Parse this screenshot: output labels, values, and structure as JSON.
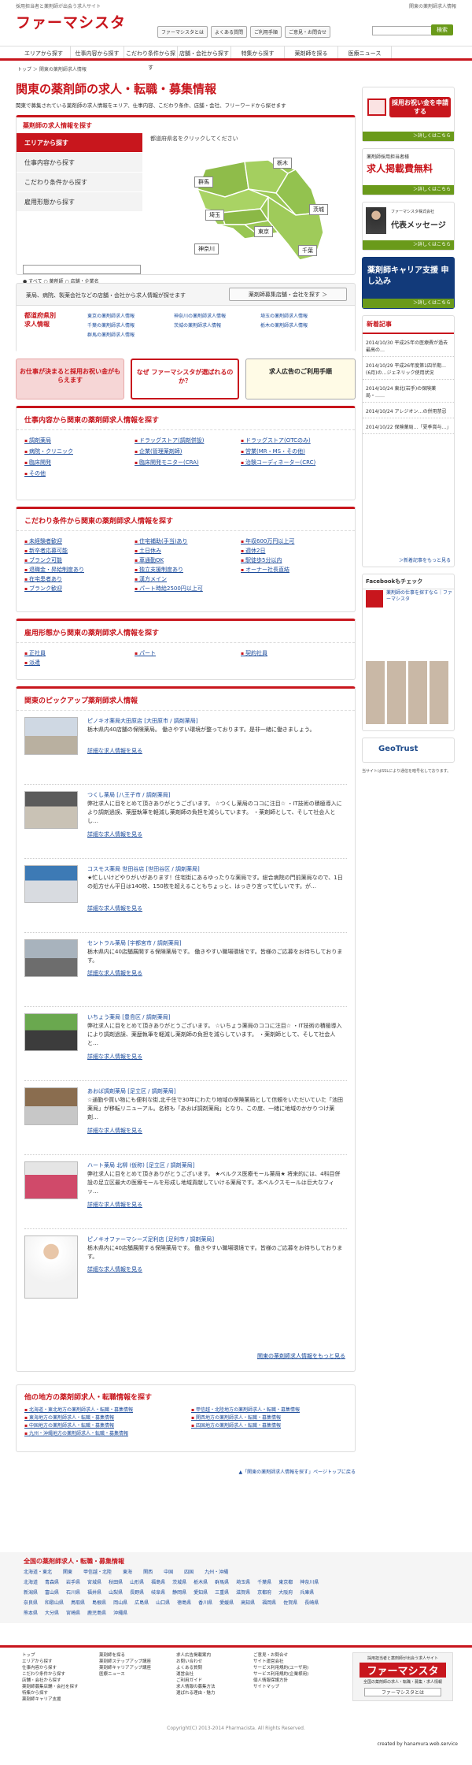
{
  "header": {
    "tagline": "採用担当者と薬剤師が出会う求人サイト",
    "logo": "ファーマシスタ",
    "right_note": "関東の薬剤師求人情報",
    "toplinks": [
      "ファーマシスタとは",
      "よくある質問",
      "ご利用手順",
      "ご意見・お問合せ"
    ],
    "search_button": "検索"
  },
  "nav": [
    "エリアから探す",
    "仕事内容から探す",
    "こだわり条件から探す",
    "店舗・会社から探す",
    "特集から探す",
    "薬剤師を探る",
    "医療ニュース"
  ],
  "breadcrumb": "トップ ＞ 関東の薬剤師求人情報",
  "main": {
    "title": "関東の薬剤師の求人・転職・募集情報",
    "lead": "関東で募集されている薬剤師の求人情報をエリア、仕事内容、こだわり条件、店舗・会社、フリーワードから探せます",
    "search_title": "薬剤師の求人情報を探す",
    "tabs": [
      "エリアから探す",
      "仕事内容から探す",
      "こだわり条件から探す",
      "雇用形態から探す"
    ],
    "map_hint": "都道府県名をクリックしてください",
    "prefs": [
      "群馬",
      "栃木",
      "茨城",
      "埼玉",
      "東京",
      "千葉",
      "神奈川"
    ],
    "radios": "● すべて ○ 薬剤師 ○ 店舗・企業名",
    "search_button": "検 索",
    "corp_text": "薬局、病院、製薬会社などの店舗・会社から求人情報が探せます",
    "corp_button": "薬剤師募集店舗・会社を探す ＞",
    "pref_label": "都道府県別求人情報",
    "pref_links": [
      "東京の薬剤師求人情報",
      "神奈川の薬剤師求人情報",
      "埼玉の薬剤師求人情報",
      "千葉の薬剤師求人情報",
      "茨城の薬剤師求人情報",
      "栃木の薬剤師求人情報",
      "群馬の薬剤師求人情報"
    ],
    "banners": [
      "お仕事が決まると採用お祝い金がもらえます",
      "なぜ ファーマシスタが選ばれるのか？",
      "求人広告のご利用手順"
    ],
    "job_title": "仕事内容から関東の薬剤師求人情報を探す",
    "jobs": [
      "調剤薬局",
      "ドラッグストア(調剤併設)",
      "ドラッグストア(OTCのみ)",
      "病院・クリニック",
      "企業(管理薬剤師)",
      "営業(MR・MS・その他)",
      "臨床開発",
      "臨床開発モニター(CRA)",
      "治験コーディネーター(CRC)",
      "その他"
    ],
    "kodawari_title": "こだわり条件から関東の薬剤師求人情報を探す",
    "kodawari": [
      "未経験者歓迎",
      "住宅補助(手当)あり",
      "年収600万円以上可",
      "新卒者応募可能",
      "土日休み",
      "週休2日",
      "ブランク可能",
      "車通勤OK",
      "駅徒歩5分以内",
      "退職金・昇給制度あり",
      "独立支援制度あり",
      "オーナー社長直結",
      "在宅患者あり",
      "漢方メイン",
      "ブランク歓迎",
      "パート時給2500円以上可"
    ],
    "koyou_title": "雇用形態から関東の薬剤師求人情報を探す",
    "koyou": [
      "正社員",
      "パート",
      "契約社員",
      "派遣"
    ],
    "pickup_title": "関東のピックアップ薬剤師求人情報",
    "pickups": [
      {
        "name": "ピノキオ薬局大田原店 [大田原市 / 調剤薬局]",
        "text": "栃木県内40店舗の保険薬局。 働きやすい環境が整っております。是非一緒に働きましょう。",
        "link": "詳細な求人情報を見る"
      },
      {
        "name": "つくし薬局 [八王子市 / 調剤薬局]",
        "text": "弊社求人に目をとめて頂きありがとうございます。 ☆つくし薬局のココに注目☆ ・IT技術の積極導入により調剤過誤、薬歴執筆を軽減し薬剤師の負担を減らしています。 ・薬剤師として、そして社会人とし…",
        "link": "詳細な求人情報を見る"
      },
      {
        "name": "コスモス薬局 世田谷店 [世田谷区 / 調剤薬局]",
        "text": "★忙しいけどやりがいがあります！住宅街にあるゆったりな薬局です。総合病院の門前薬局なので、1日の処方せん平日は140枚、150枚を超えることもちょっと、はっきり言って忙しいです。が…",
        "link": "詳細な求人情報を見る"
      },
      {
        "name": "セントラル薬局 [宇都宮市 / 調剤薬局]",
        "text": "栃木県内に40店舗展開する保険薬局です。 働きやすい職場環境です。皆様のご応募をお待ちしております。",
        "link": "詳細な求人情報を見る"
      },
      {
        "name": "いちょう薬局 [豊島区 / 調剤薬局]",
        "text": "弊社求人に目をとめて頂きありがとうございます。 ☆いちょう薬局のココに注目☆ ・IT技術の積極導入により調剤過誤、薬歴執筆を軽減し薬剤師の負担を減らしています。 ・薬剤師として、そして社会人と…",
        "link": "詳細な求人情報を見る"
      },
      {
        "name": "あおば調剤薬局 [足立区 / 調剤薬局]",
        "text": "☆通勤や買い物にも便利な街,北千住で30年にわたり地域の保険薬局として信頼をいただいていた「池田薬局」が移転リニューアル。名称も「あおば調剤薬局」となり、この度、一緒に地域のかかりつけ薬剤…",
        "link": "詳細な求人情報を見る"
      },
      {
        "name": "ハート薬局 北柳 (仮称) [足立区 / 調剤薬局]",
        "text": "弊社求人に目をとめて頂きありがとうございます。 ★ベルクス医療モール薬局★ 将来的には、4科目併設の足立区最大の医療モールを形成し地域貢献していける薬局です。本ベルクスモールは巨大なフィッ…",
        "link": "詳細な求人情報を見る"
      },
      {
        "name": "ピノキオファーマシーズ足利店 [足利市 / 調剤薬局]",
        "text": "栃木県内に40店舗展開する保険薬局です。 働きやすい職場環境です。皆様のご応募をお待ちしております。",
        "link": "詳細な求人情報を見る"
      }
    ],
    "pickup_more": "関東の薬剤師求人情報をもっと見る",
    "other_title": "他の地方の薬剤師求人・転職情報を探す",
    "other": [
      "北海道・東北地方の薬剤師求人・転職・募集情報",
      "甲信越・北陸地方の薬剤師求人・転職・募集情報",
      "東海地方の薬剤師求人・転職・募集情報",
      "関西地方の薬剤師求人・転職・募集情報",
      "中国地方の薬剤師求人・転職・募集情報",
      "四国地方の薬剤師求人・転職・募集情報",
      "九州・沖縄地方の薬剤師求人・転職・募集情報"
    ],
    "pagetop": "▲「関東の薬剤師求人情報を探す」ページトップに戻る"
  },
  "national": {
    "title": "全国の薬剤師求人・転職・募集情報",
    "rows": [
      [
        "北海道・東北",
        "関東",
        "甲信越・北陸",
        "東海",
        "関西",
        "中国",
        "四国",
        "九州・沖縄"
      ],
      [
        "北海道",
        "青森県",
        "岩手県",
        "宮城県",
        "秋田県",
        "山形県",
        "福島県",
        "茨城県",
        "栃木県",
        "群馬県",
        "埼玉県",
        "千葉県",
        "東京都",
        "神奈川県"
      ],
      [
        "新潟県",
        "富山県",
        "石川県",
        "福井県",
        "山梨県",
        "長野県",
        "岐阜県",
        "静岡県",
        "愛知県",
        "三重県",
        "滋賀県",
        "京都府",
        "大阪府",
        "兵庫県"
      ],
      [
        "奈良県",
        "和歌山県",
        "鳥取県",
        "島根県",
        "岡山県",
        "広島県",
        "山口県",
        "徳島県",
        "香川県",
        "愛媛県",
        "高知県",
        "福岡県",
        "佐賀県",
        "長崎県"
      ],
      [
        "熊本県",
        "大分県",
        "宮崎県",
        "鹿児島県",
        "沖縄県"
      ]
    ]
  },
  "side": {
    "oiwai": "採用お祝い金を申請する",
    "oiwai_more": "＞詳しくはこちら",
    "free_note": "薬剤師採用担当者様",
    "free": "求人掲載費無料",
    "free_more": "＞詳しくはこちら",
    "msg_note": "ファーマシスタ株式会社",
    "msg": "代表メッセージ",
    "msg_more": "＞詳しくはこちら",
    "career": "薬剤師キャリア支援 申し込み",
    "career_more": "＞詳しくはこちら",
    "news_title": "新着記事",
    "news": [
      "2014/10/30 平成25年の医療費が過去最高の…",
      "2014/10/29 平成26年度第1四半期…(6月)の…ジェネリック使用状況",
      "2014/10/24 東北(岩手)の保険薬局・……",
      "2014/10/24 アレジオン…の併用禁忌",
      "2014/10/22 保険薬局…「夏季賞与…」"
    ],
    "news_more": "＞新着記事をもっと見る",
    "fb_title": "Facebookもチェック",
    "fb_page": "薬剤師の仕事を探すなら｜ファーマシスタ",
    "ssl": "GeoTrust",
    "ssl_note": "当サイトはSSLにより通信を暗号化しております。"
  },
  "footer": {
    "cols": [
      [
        "トップ",
        "エリアから探す",
        "仕事内容から探す",
        "こだわり条件から探す",
        "店舗・会社から探す",
        "薬剤師募集店舗・会社を探す",
        "特集から探す",
        "薬剤師キャリア支援"
      ],
      [
        "薬剤師を探る",
        "薬剤師ステップアップ講座",
        "薬剤師キャリアアップ講座",
        "医療ニュース"
      ],
      [
        "求人広告掲載案内",
        "お問い合わせ",
        "よくある質問",
        "運営会社",
        "ご利用ガイド",
        "求人情報の募集方法",
        "選ばれる理由・魅力"
      ],
      [
        "ご意見・お問合せ",
        "サイト運営会社",
        "サービス利用規約(ユーザ用)",
        "サービス利用規約(企業様用)",
        "個人情報保護方針",
        "サイトマップ"
      ]
    ],
    "logo_tag": "採用担当者と薬剤師が出会う求人サイト",
    "logo": "ファーマシスタ",
    "desc": "全国の薬剤師の求人・転職・募集・求人情報",
    "btn": "ファーマシスタとは",
    "copyright": "Copyright(C) 2013-2014 Pharmacista. All Rights Reserved.",
    "created": "created by hanamura.web.service"
  },
  "colors": {
    "accent": "#c8161d",
    "green": "#6a9a1a",
    "map": "#9bc856"
  }
}
